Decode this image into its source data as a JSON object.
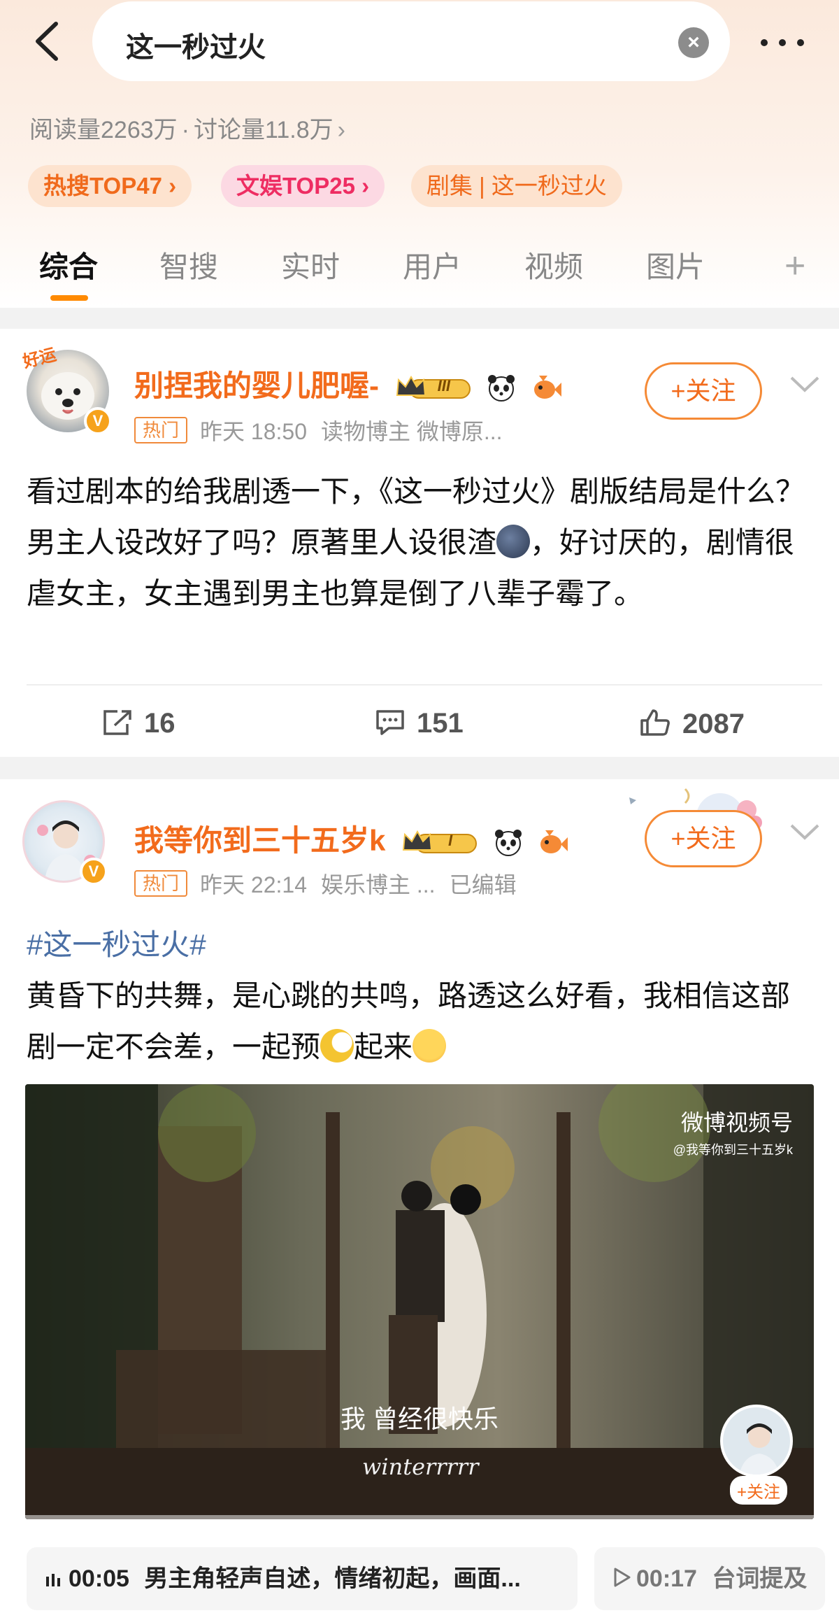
{
  "search": {
    "query": "这一秒过火"
  },
  "stats": {
    "reads": "阅读量2263万",
    "dot": "·",
    "discuss": "讨论量11.8万",
    "chevron": "›"
  },
  "pills": [
    {
      "label": "热搜TOP47 ›"
    },
    {
      "label": "文娱TOP25 ›"
    },
    {
      "label": "剧集 | 这一秒过火"
    }
  ],
  "tabs": [
    "综合",
    "智搜",
    "实时",
    "用户",
    "视频",
    "图片"
  ],
  "tab_plus": "+",
  "posts": [
    {
      "username": "别捏我的婴儿肥喔-",
      "crown_level": "III",
      "hot_tag": "热门",
      "time": "昨天 18:50",
      "source": "读物博主 微博原...",
      "follow": "+关注",
      "text_before": "看过剧本的给我剧透一下，《这一秒过火》剧版结局是什么？男主人设改好了吗？原著里人设很渣",
      "text_after": "，好讨厌的，剧情很虐女主，女主遇到男主也算是倒了八辈子霉了。",
      "reposts": "16",
      "comments": "151",
      "likes": "2087",
      "verify": "V",
      "avatar_sticker": "好运"
    },
    {
      "username": "我等你到三十五岁k",
      "crown_level": "I",
      "hot_tag": "热门",
      "time": "昨天 22:14",
      "source": "娱乐博主 ...",
      "edited": "已编辑",
      "follow": "+关注",
      "hashtag": "#这一秒过火#",
      "text_before": "黄昏下的共舞，是心跳的共鸣，路透这么好看，我相信这部剧一定不会差，一起预",
      "text_mid": "起来",
      "verify": "V",
      "video": {
        "logo": "微博视频号",
        "logo_handle": "@我等你到三十五岁k",
        "subtitle": "我  曾经很快乐",
        "signature": "winterrrrr",
        "follow": "+关注"
      },
      "chapters": [
        {
          "time": "00:05",
          "desc": "男主角轻声自述，情绪初起，画面..."
        },
        {
          "time": "00:17",
          "desc": "台词提及"
        }
      ]
    }
  ],
  "colors": {
    "accent": "#f26b1c",
    "hot_pink": "#ee2d62",
    "hashtag": "#4a6fa5",
    "tab_underline": "#ff8a00"
  }
}
